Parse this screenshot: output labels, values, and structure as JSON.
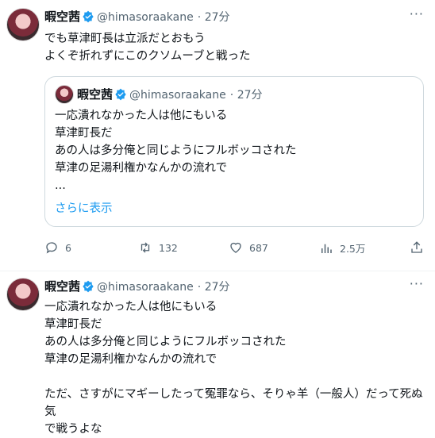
{
  "tweet1": {
    "name": "暇空茜",
    "handle": "@himasoraakane",
    "time": "· 27分",
    "text": "でも草津町長は立派だとおもう\nよくぞ折れずにこのクソムーブと戦った",
    "quote": {
      "name": "暇空茜",
      "handle": "@himasoraakane",
      "time": "· 27分",
      "text": "一応潰れなかった人は他にもいる\n草津町長だ\nあの人は多分俺と同じようにフルボッコされた\n草津の足湯利権かなんかの流れで\n...",
      "show_more": "さらに表示"
    },
    "actions": {
      "replies": "6",
      "retweets": "132",
      "likes": "687",
      "views": "2.5万"
    }
  },
  "tweet2": {
    "name": "暇空茜",
    "handle": "@himasoraakane",
    "time": "· 27分",
    "text": "一応潰れなかった人は他にもいる\n草津町長だ\nあの人は多分俺と同じようにフルボッコされた\n草津の足湯利権かなんかの流れで\n\nただ、さすがにマギーしたって冤罪なら、そりゃ羊（一般人）だって死ぬ気\nで戦うよな"
  },
  "more_icon": "···",
  "colors": {
    "accent": "#1d9bf0",
    "muted": "#536471",
    "border": "#cfd9de"
  },
  "icons": [
    "verified-badge-icon",
    "more-icon",
    "reply-icon",
    "retweet-icon",
    "like-icon",
    "views-icon",
    "share-icon"
  ]
}
